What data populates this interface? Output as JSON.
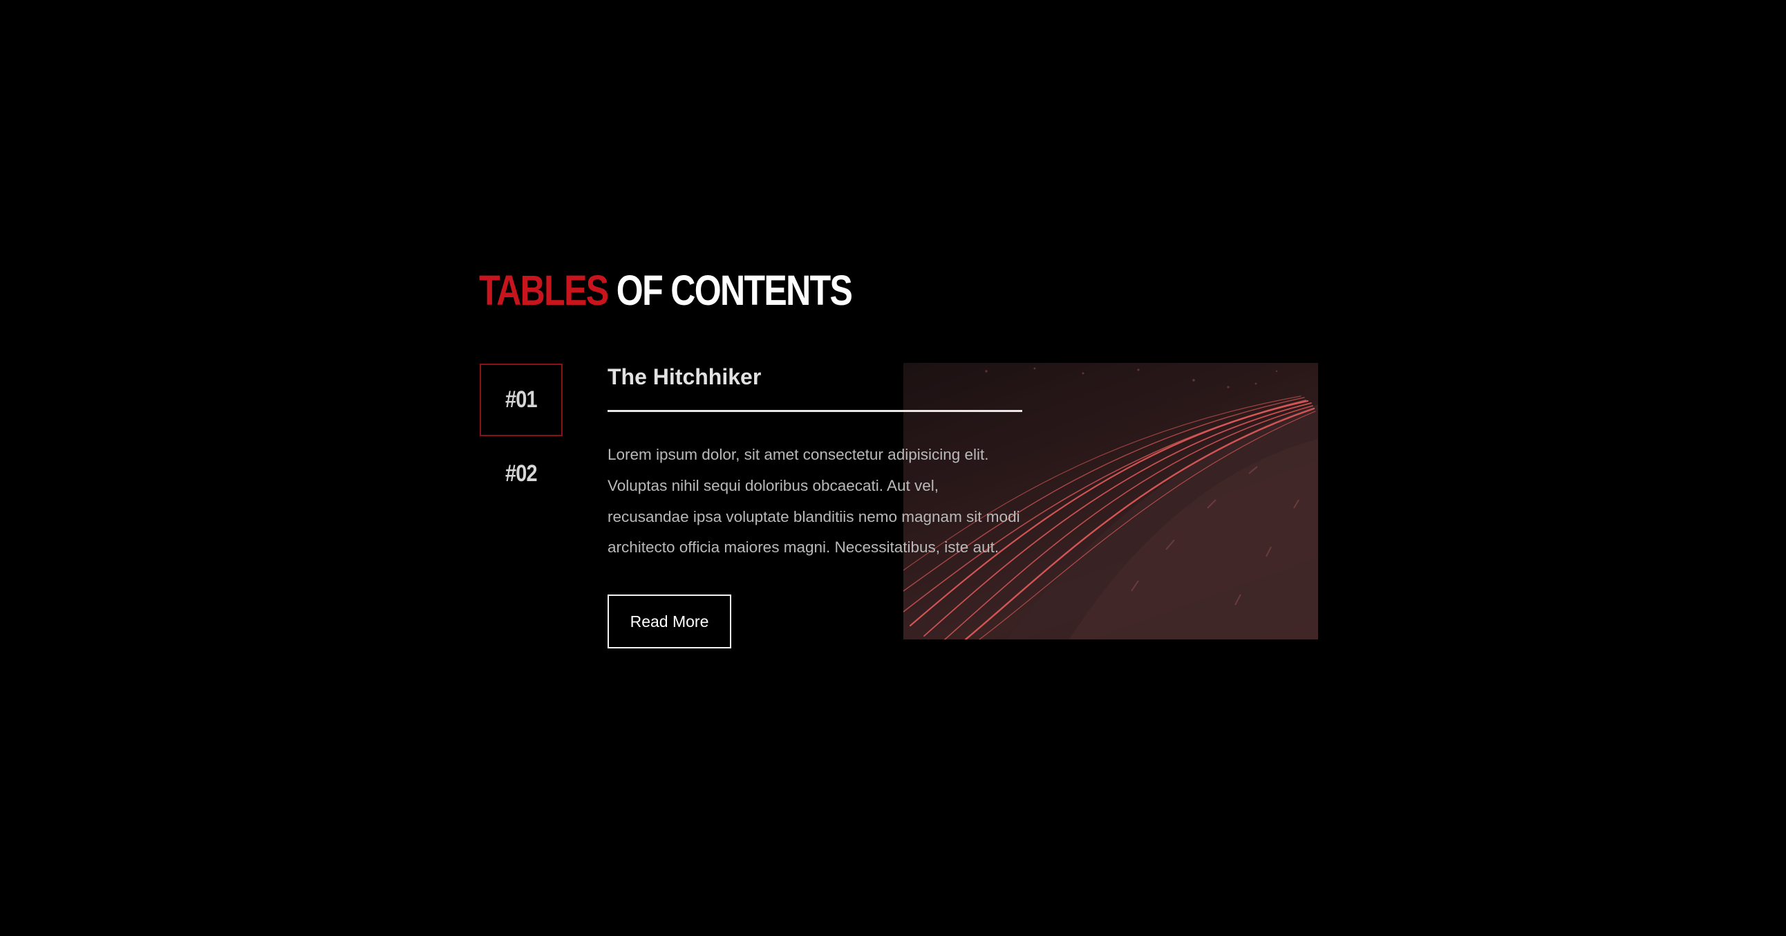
{
  "heading": {
    "accent": "TABLES",
    "rest": "OF CONTENTS"
  },
  "tabs": [
    {
      "label": "#01",
      "active": true
    },
    {
      "label": "#02",
      "active": false
    }
  ],
  "entry": {
    "title": "The Hitchhiker",
    "body": "Lorem ipsum dolor, sit amet consectetur adipisicing elit. Voluptas nihil sequi doloribus obcaecati. Aut vel, recusandae ipsa voluptate blanditiis nemo magnam sit modi architecto officia maiores magni. Necessitatibus, iste aut.",
    "button_label": "Read More",
    "image_icon": "highway-light-trails-image"
  },
  "colors": {
    "background": "#000000",
    "accent": "#c8141c",
    "active_tab_border": "#8a1116",
    "light_trail": "#e05a5a"
  }
}
